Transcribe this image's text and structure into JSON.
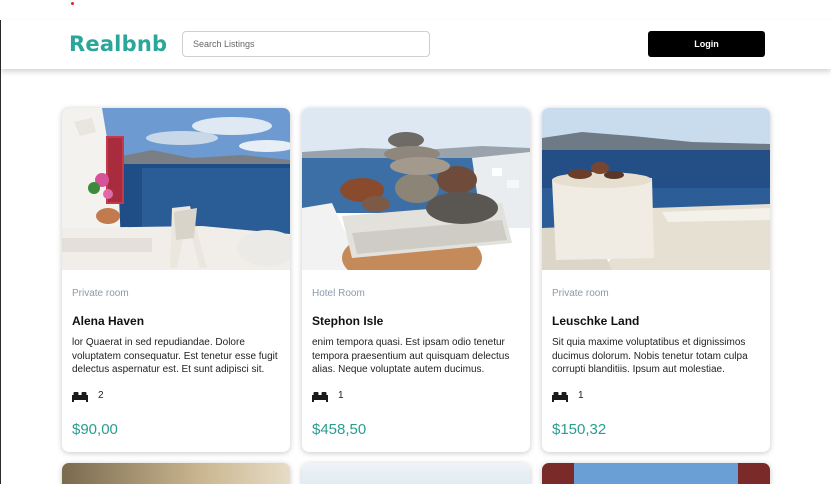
{
  "header": {
    "brand": "Realbnb",
    "search_placeholder": "Search Listings",
    "login_label": "Login"
  },
  "listings": [
    {
      "type": "Private room",
      "title": "Alena Haven",
      "description": "lor Quaerat in sed repudiandae. Dolore voluptatem consequatur. Est tenetur esse fugit delectus aspernatur est. Et sunt adipisci sit.",
      "beds": "2",
      "price": "$90,00"
    },
    {
      "type": "Hotel Room",
      "title": "Stephon Isle",
      "description": "enim tempora quasi. Est ipsam odio tenetur tempora praesentium aut quisquam delectus alias. Neque voluptate autem ducimus.",
      "beds": "1",
      "price": "$458,50"
    },
    {
      "type": "Private room",
      "title": "Leuschke Land",
      "description": "Sit quia maxime voluptatibus et dignissimos ducimus dolorum. Nobis tenetur totam culpa corrupti blanditiis. Ipsum aut molestiae.",
      "beds": "1",
      "price": "$150,32"
    }
  ],
  "icons": {
    "bed": "bed-icon"
  },
  "colors": {
    "brand": "#2aa69a",
    "price": "#2a9d8f",
    "login_bg": "#000000"
  }
}
